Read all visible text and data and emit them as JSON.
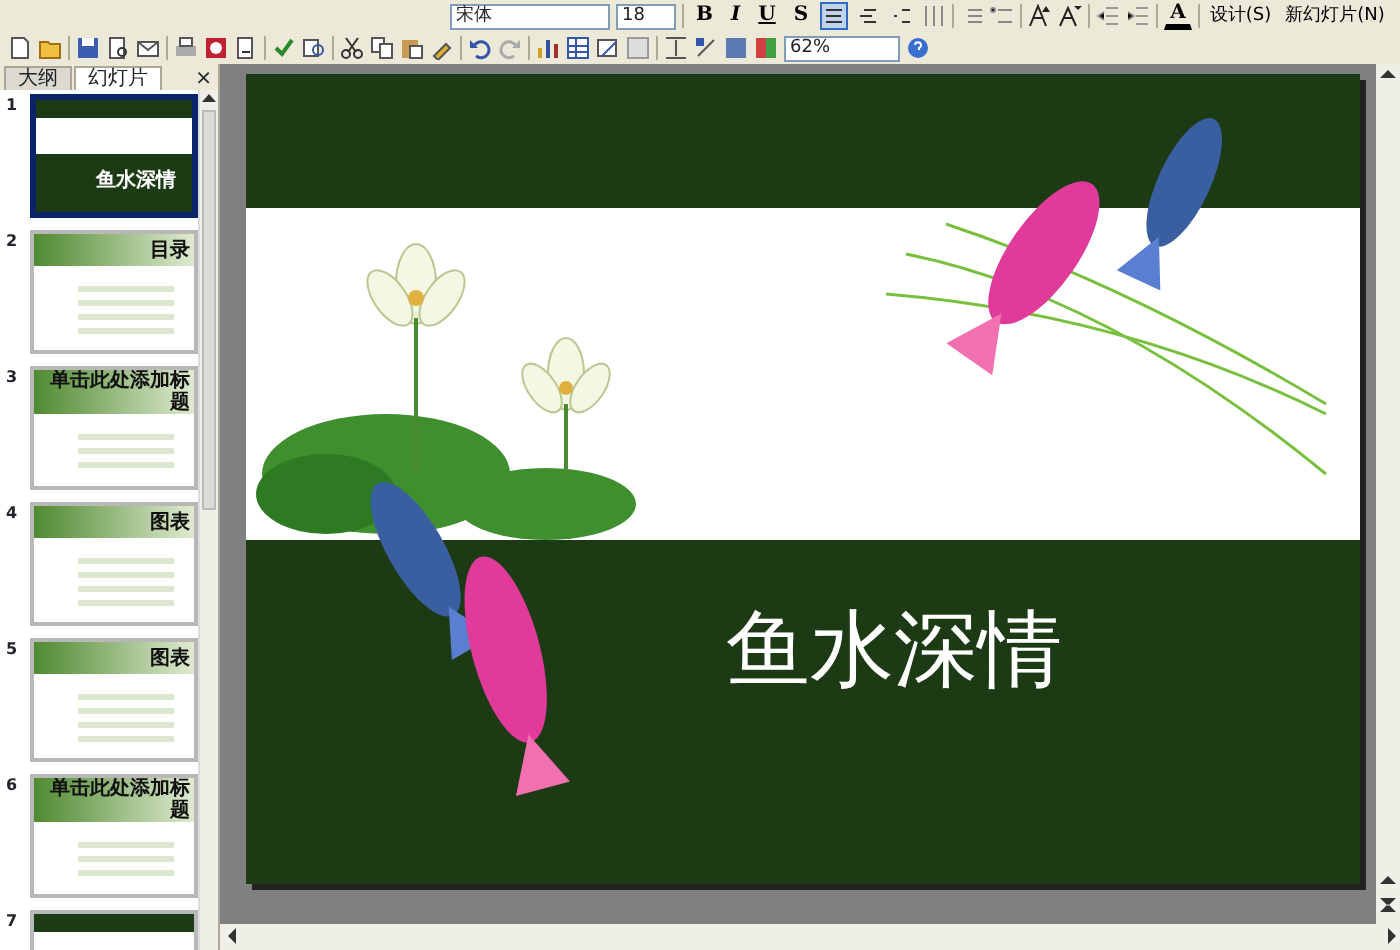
{
  "toolbar": {
    "font": "宋体",
    "font_size": "18",
    "format_buttons": [
      {
        "label": "B",
        "selected": false
      },
      {
        "label": "I",
        "selected": false
      },
      {
        "label": "U",
        "selected": false
      },
      {
        "label": "S",
        "selected": false
      }
    ],
    "align_buttons": [
      {
        "selected": true
      },
      {
        "selected": false
      },
      {
        "selected": false
      }
    ],
    "font_color_glyph": "A",
    "design_button": "设计(S)",
    "new_slide_button": "新幻灯片(N)",
    "zoom": "62%"
  },
  "pane_tabs": [
    {
      "label": "大纲",
      "selected": false
    },
    {
      "label": "幻灯片",
      "selected": true
    }
  ],
  "pane_close": "×",
  "slides": [
    {
      "number": "1",
      "kind": "cover",
      "title": "鱼水深情",
      "selected": true
    },
    {
      "number": "2",
      "kind": "content",
      "title": "目录",
      "selected": false
    },
    {
      "number": "3",
      "kind": "content",
      "title": "单击此处添加标题",
      "selected": false
    },
    {
      "number": "4",
      "kind": "content",
      "title": "图表",
      "selected": false
    },
    {
      "number": "5",
      "kind": "content",
      "title": "图表",
      "selected": false
    },
    {
      "number": "6",
      "kind": "content",
      "title": "单击此处添加标题",
      "selected": false
    },
    {
      "number": "7",
      "kind": "cover",
      "selected": false
    }
  ],
  "slide": {
    "title": "鱼水深情"
  }
}
